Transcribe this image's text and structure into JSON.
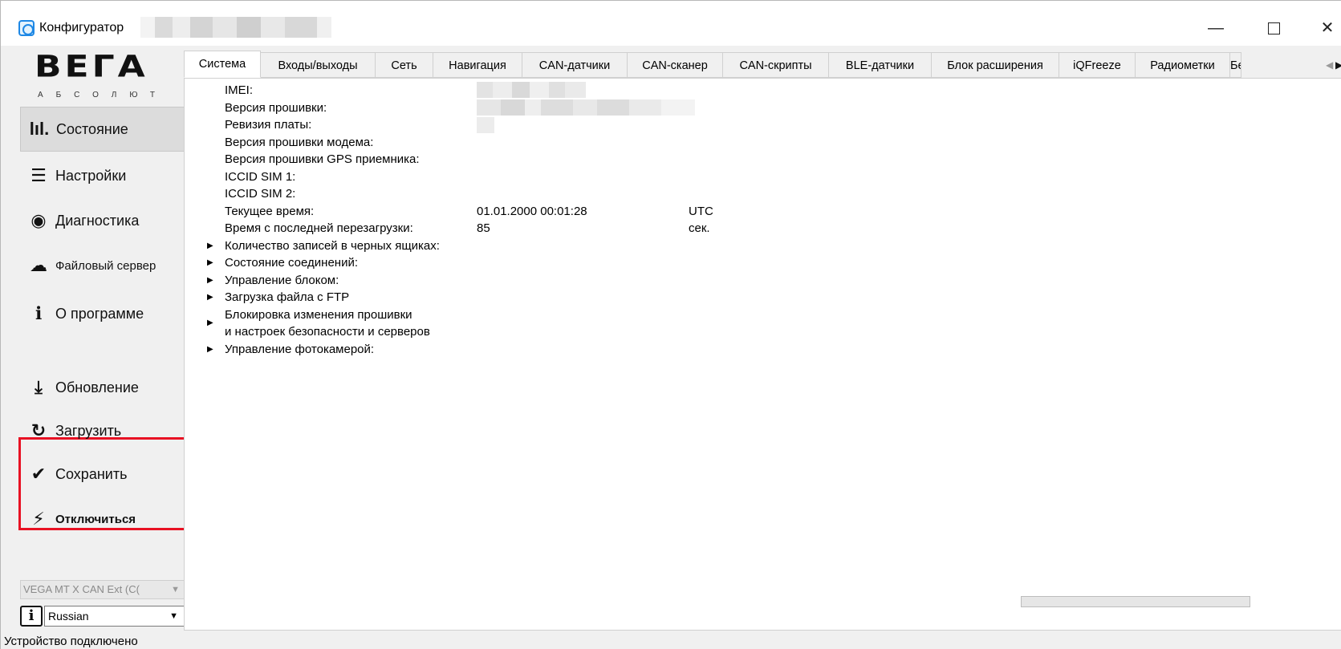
{
  "window": {
    "title": "Конфигуратор",
    "controls": {
      "minimize": "—",
      "maximize": "☐",
      "close": "✕"
    }
  },
  "sidebar": {
    "logo": "ВЕГА",
    "logo_sub": "АБСОЛЮТ",
    "items": [
      {
        "label": "Состояние",
        "icon": "bar-chart-icon",
        "glyph": "lıl.",
        "active": true
      },
      {
        "label": "Настройки",
        "icon": "sliders-icon",
        "glyph": "☰",
        "active": false
      },
      {
        "label": "Диагностика",
        "icon": "eye-icon",
        "glyph": "◉",
        "active": false
      },
      {
        "label": "Файловый сервер",
        "icon": "cloud-download-icon",
        "glyph": "☁",
        "active": false
      },
      {
        "label": "О программе",
        "icon": "info-icon",
        "glyph": "ℹ",
        "active": false
      },
      {
        "label": "Обновление",
        "icon": "download-icon",
        "glyph": "⤓",
        "active": false
      },
      {
        "label": "Загрузить",
        "icon": "reload-icon",
        "glyph": "↻",
        "active": false
      },
      {
        "label": "Сохранить",
        "icon": "checkmark-icon",
        "glyph": "✔",
        "active": false
      },
      {
        "label": "Отключиться",
        "icon": "plug-icon",
        "glyph": "⚡",
        "active": false
      }
    ],
    "device_select": "VEGA MT X CAN Ext (C(",
    "language_select": "Russian",
    "info_glyph": "i",
    "status": "Устройство подключено"
  },
  "tabs": [
    {
      "label": "Система",
      "active": true
    },
    {
      "label": "Входы/выходы",
      "active": false
    },
    {
      "label": "Сеть",
      "active": false
    },
    {
      "label": "Навигация",
      "active": false
    },
    {
      "label": "CAN-датчики",
      "active": false
    },
    {
      "label": "CAN-сканер",
      "active": false
    },
    {
      "label": "CAN-скрипты",
      "active": false
    },
    {
      "label": "BLE-датчики",
      "active": false
    },
    {
      "label": "Блок расширения",
      "active": false
    },
    {
      "label": "iQFreeze",
      "active": false
    },
    {
      "label": "Радиометки",
      "active": false
    },
    {
      "label": "Бе",
      "active": false
    }
  ],
  "system": {
    "fields": [
      {
        "label": "IMEI:"
      },
      {
        "label": "Версия прошивки:"
      },
      {
        "label": "Ревизия платы:"
      },
      {
        "label": "Версия прошивки модема:"
      },
      {
        "label": "Версия прошивки GPS приемника:"
      },
      {
        "label": "ICCID SIM 1:"
      },
      {
        "label": "ICCID SIM 2:"
      },
      {
        "label": "Текущее время:",
        "value": "01.01.2000 00:01:28",
        "unit": "UTC"
      },
      {
        "label": "Время с последней перезагрузки:",
        "value": "85",
        "unit": "сек."
      }
    ],
    "groups": [
      "Количество записей в черных ящиках:",
      "Состояние соединений:",
      "Управление блоком:",
      "Загрузка файла с FTP",
      "Блокировка изменения прошивки",
      "и настроек безопасности и серверов",
      "Управление фотокамерой:"
    ],
    "expand_glyph": "▶"
  },
  "progress": 0,
  "colors": {
    "highlight_border": "#e81123",
    "active_nav_bg": "#dcdcdc"
  }
}
